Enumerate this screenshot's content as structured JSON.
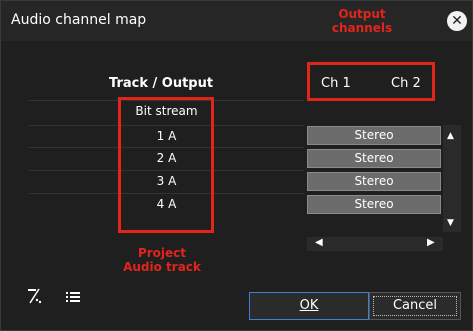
{
  "window": {
    "title": "Audio channel map",
    "close_glyph": "✕"
  },
  "annotations": {
    "output_line1": "Output",
    "output_line2": "channels",
    "project_line1": "Project",
    "project_line2": "Audio track"
  },
  "table": {
    "header": "Track / Output",
    "channels": [
      "Ch 1",
      "Ch 2"
    ],
    "rows": [
      {
        "label": "Bit stream",
        "value": ""
      },
      {
        "label": "1 A",
        "value": "Stereo"
      },
      {
        "label": "2 A",
        "value": "Stereo"
      },
      {
        "label": "3 A",
        "value": "Stereo"
      },
      {
        "label": "4 A",
        "value": "Stereo"
      }
    ]
  },
  "buttons": {
    "ok": "OK",
    "cancel": "Cancel"
  },
  "icons": {
    "toolbar1": "auto-map-icon",
    "toolbar2": "list-icon"
  },
  "colors": {
    "annotation": "#e1251b",
    "background": "#1f1f1f",
    "cell": "#6c6c6c",
    "primary_border": "#3f7fd9"
  }
}
